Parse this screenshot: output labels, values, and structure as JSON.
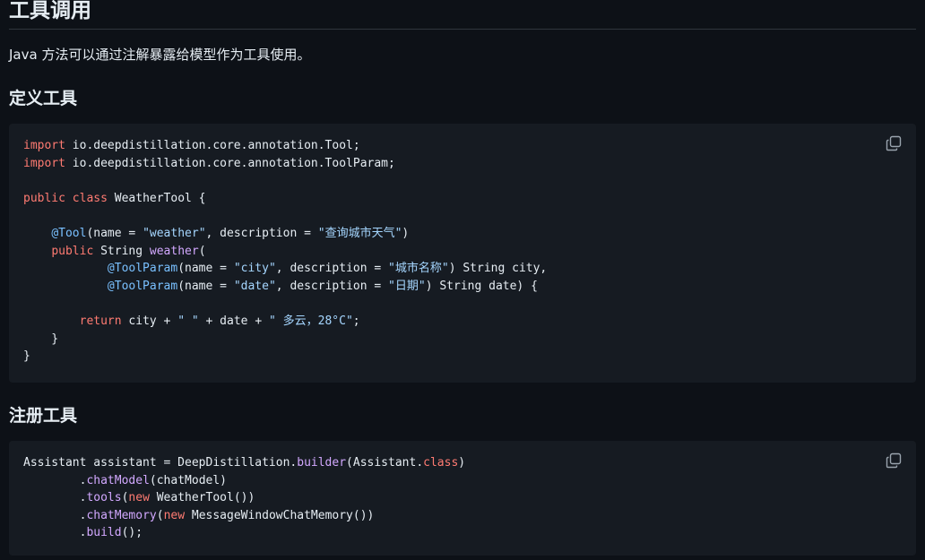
{
  "heading": "工具调用",
  "intro": "Java 方法可以通过注解暴露给模型作为工具使用。",
  "sections": [
    {
      "title": "定义工具"
    },
    {
      "title": "注册工具"
    }
  ],
  "copy_icon": "copy-icon",
  "colors": {
    "keyword": "#ff7b72",
    "annotation": "#79c0ff",
    "string": "#a5d6ff",
    "method": "#d2a8ff",
    "plain": "#e6edf3"
  },
  "code_blocks": [
    {
      "lines": [
        [
          [
            "import",
            "keyword"
          ],
          [
            " io.deepdistillation.core.annotation.Tool;",
            "plain"
          ]
        ],
        [
          [
            "import",
            "keyword"
          ],
          [
            " io.deepdistillation.core.annotation.ToolParam;",
            "plain"
          ]
        ],
        [
          [
            "",
            "plain"
          ]
        ],
        [
          [
            "public",
            "keyword"
          ],
          [
            " ",
            "plain"
          ],
          [
            "class",
            "keyword"
          ],
          [
            " WeatherTool {",
            "plain"
          ]
        ],
        [
          [
            "",
            "plain"
          ]
        ],
        [
          [
            "    ",
            "plain"
          ],
          [
            "@Tool",
            "annotation"
          ],
          [
            "(name = ",
            "plain"
          ],
          [
            "\"weather\"",
            "string"
          ],
          [
            ", description = ",
            "plain"
          ],
          [
            "\"查询城市天气\"",
            "string"
          ],
          [
            ")",
            "plain"
          ]
        ],
        [
          [
            "    ",
            "plain"
          ],
          [
            "public",
            "keyword"
          ],
          [
            " String ",
            "plain"
          ],
          [
            "weather",
            "method"
          ],
          [
            "(",
            "plain"
          ]
        ],
        [
          [
            "            ",
            "plain"
          ],
          [
            "@ToolParam",
            "annotation"
          ],
          [
            "(name = ",
            "plain"
          ],
          [
            "\"city\"",
            "string"
          ],
          [
            ", description = ",
            "plain"
          ],
          [
            "\"城市名称\"",
            "string"
          ],
          [
            ") String city,",
            "plain"
          ]
        ],
        [
          [
            "            ",
            "plain"
          ],
          [
            "@ToolParam",
            "annotation"
          ],
          [
            "(name = ",
            "plain"
          ],
          [
            "\"date\"",
            "string"
          ],
          [
            ", description = ",
            "plain"
          ],
          [
            "\"日期\"",
            "string"
          ],
          [
            ") String date) {",
            "plain"
          ]
        ],
        [
          [
            "",
            "plain"
          ]
        ],
        [
          [
            "        ",
            "plain"
          ],
          [
            "return",
            "keyword"
          ],
          [
            " city + ",
            "plain"
          ],
          [
            "\" \"",
            "string"
          ],
          [
            " + date + ",
            "plain"
          ],
          [
            "\" 多云，28°C\"",
            "string"
          ],
          [
            ";",
            "plain"
          ]
        ],
        [
          [
            "    }",
            "plain"
          ]
        ],
        [
          [
            "}",
            "plain"
          ]
        ]
      ]
    },
    {
      "lines": [
        [
          [
            "Assistant assistant = DeepDistillation.",
            "plain"
          ],
          [
            "builder",
            "method"
          ],
          [
            "(Assistant.",
            "plain"
          ],
          [
            "class",
            "keyword"
          ],
          [
            ")",
            "plain"
          ]
        ],
        [
          [
            "        .",
            "plain"
          ],
          [
            "chatModel",
            "method"
          ],
          [
            "(chatModel)",
            "plain"
          ]
        ],
        [
          [
            "        .",
            "plain"
          ],
          [
            "tools",
            "method"
          ],
          [
            "(",
            "plain"
          ],
          [
            "new",
            "keyword"
          ],
          [
            " WeatherTool())",
            "plain"
          ]
        ],
        [
          [
            "        .",
            "plain"
          ],
          [
            "chatMemory",
            "method"
          ],
          [
            "(",
            "plain"
          ],
          [
            "new",
            "keyword"
          ],
          [
            " MessageWindowChatMemory())",
            "plain"
          ]
        ],
        [
          [
            "        .",
            "plain"
          ],
          [
            "build",
            "method"
          ],
          [
            "();",
            "plain"
          ]
        ]
      ]
    }
  ]
}
